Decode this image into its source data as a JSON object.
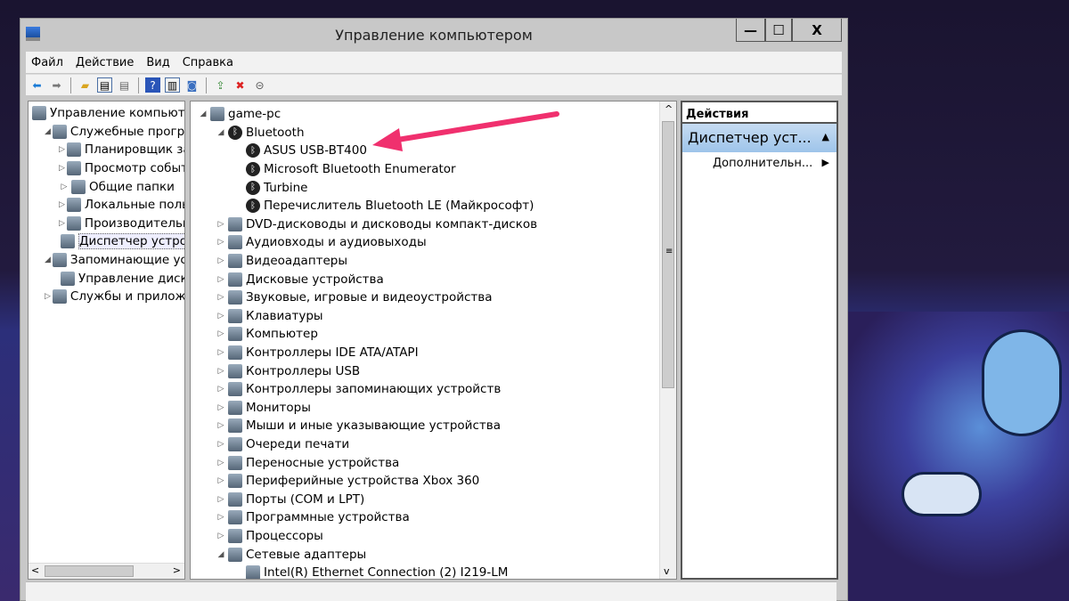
{
  "window": {
    "title": "Управление компьютером",
    "minimize": "—",
    "maximize": "☐",
    "close": "X"
  },
  "menu": [
    "Файл",
    "Действие",
    "Вид",
    "Справка"
  ],
  "toolbar_icons": [
    "back-arrow-icon",
    "forward-arrow-icon",
    "up-folder-icon",
    "show-hide-console-tree-icon",
    "properties-icon",
    "help-icon",
    "show-hide-action-pane-icon",
    "scan-hardware-icon",
    "update-driver-icon",
    "uninstall-device-icon",
    "disable-device-icon"
  ],
  "left_tree": [
    {
      "label": "Управление компьютером",
      "level": 0,
      "exp": ""
    },
    {
      "label": "Служебные программы",
      "level": 1,
      "exp": "◢"
    },
    {
      "label": "Планировщик заданий",
      "level": 2,
      "exp": "▷"
    },
    {
      "label": "Просмотр событий",
      "level": 2,
      "exp": "▷"
    },
    {
      "label": "Общие папки",
      "level": 2,
      "exp": "▷"
    },
    {
      "label": "Локальные пользователи",
      "level": 2,
      "exp": "▷"
    },
    {
      "label": "Производительность",
      "level": 2,
      "exp": "▷"
    },
    {
      "label": "Диспетчер устройств",
      "level": 2,
      "exp": "",
      "selected": true
    },
    {
      "label": "Запоминающие устройства",
      "level": 1,
      "exp": "◢"
    },
    {
      "label": "Управление дисками",
      "level": 2,
      "exp": ""
    },
    {
      "label": "Службы и приложения",
      "level": 1,
      "exp": "▷"
    }
  ],
  "device_tree": [
    {
      "label": "game-pc",
      "level": 0,
      "exp": "◢",
      "icon": "computer"
    },
    {
      "label": "Bluetooth",
      "level": 1,
      "exp": "◢",
      "icon": "bt"
    },
    {
      "label": "ASUS USB-BT400",
      "level": 2,
      "exp": "",
      "icon": "bt"
    },
    {
      "label": "Microsoft Bluetooth Enumerator",
      "level": 2,
      "exp": "",
      "icon": "bt"
    },
    {
      "label": "Turbine",
      "level": 2,
      "exp": "",
      "icon": "bt"
    },
    {
      "label": "Перечислитель Bluetooth LE (Майкрософт)",
      "level": 2,
      "exp": "",
      "icon": "bt"
    },
    {
      "label": "DVD-дисководы и дисководы компакт-дисков",
      "level": 1,
      "exp": "▷",
      "icon": "dev"
    },
    {
      "label": "Аудиовходы и аудиовыходы",
      "level": 1,
      "exp": "▷",
      "icon": "dev"
    },
    {
      "label": "Видеоадаптеры",
      "level": 1,
      "exp": "▷",
      "icon": "dev"
    },
    {
      "label": "Дисковые устройства",
      "level": 1,
      "exp": "▷",
      "icon": "dev"
    },
    {
      "label": "Звуковые, игровые и видеоустройства",
      "level": 1,
      "exp": "▷",
      "icon": "dev"
    },
    {
      "label": "Клавиатуры",
      "level": 1,
      "exp": "▷",
      "icon": "dev"
    },
    {
      "label": "Компьютер",
      "level": 1,
      "exp": "▷",
      "icon": "dev"
    },
    {
      "label": "Контроллеры IDE ATA/ATAPI",
      "level": 1,
      "exp": "▷",
      "icon": "dev"
    },
    {
      "label": "Контроллеры USB",
      "level": 1,
      "exp": "▷",
      "icon": "dev"
    },
    {
      "label": "Контроллеры запоминающих устройств",
      "level": 1,
      "exp": "▷",
      "icon": "dev"
    },
    {
      "label": "Мониторы",
      "level": 1,
      "exp": "▷",
      "icon": "dev"
    },
    {
      "label": "Мыши и иные указывающие устройства",
      "level": 1,
      "exp": "▷",
      "icon": "dev"
    },
    {
      "label": "Очереди печати",
      "level": 1,
      "exp": "▷",
      "icon": "dev"
    },
    {
      "label": "Переносные устройства",
      "level": 1,
      "exp": "▷",
      "icon": "dev"
    },
    {
      "label": "Периферийные устройства Xbox 360",
      "level": 1,
      "exp": "▷",
      "icon": "dev"
    },
    {
      "label": "Порты (COM и LPT)",
      "level": 1,
      "exp": "▷",
      "icon": "dev"
    },
    {
      "label": "Программные устройства",
      "level": 1,
      "exp": "▷",
      "icon": "dev"
    },
    {
      "label": "Процессоры",
      "level": 1,
      "exp": "▷",
      "icon": "dev"
    },
    {
      "label": "Сетевые адаптеры",
      "level": 1,
      "exp": "◢",
      "icon": "dev"
    },
    {
      "label": "Intel(R) Ethernet Connection (2) I219-LM",
      "level": 2,
      "exp": "",
      "icon": "dev"
    }
  ],
  "actions": {
    "header": "Действия",
    "section": "Диспетчер уст...",
    "item": "Дополнительн..."
  },
  "annotation": {
    "arrow_color": "#f0306e"
  }
}
